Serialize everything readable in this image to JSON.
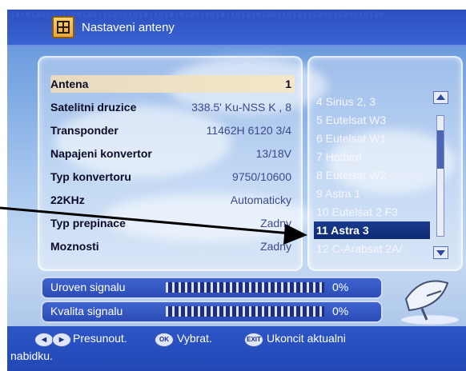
{
  "header": {
    "title": "Nastaveni anteny",
    "pattern": "1010100010110010011101010101101010100100101101010100110101110101101010100"
  },
  "settings": [
    {
      "label": "Antena",
      "value": "1",
      "selected": true
    },
    {
      "label": "Satelitni druzice",
      "value": "338.5' Ku-NSS K , 8"
    },
    {
      "label": "Transponder",
      "value": "11462H 6120 3/4"
    },
    {
      "label": "Napajeni konvertor",
      "value": "13/18V"
    },
    {
      "label": "Typ konvertoru",
      "value": "9750/10600"
    },
    {
      "label": "22KHz",
      "value": "Automaticky"
    },
    {
      "label": "Typ prepinace",
      "value": "Zadny"
    },
    {
      "label": "Moznosti",
      "value": "Zadny"
    }
  ],
  "satellites": [
    {
      "label": "4 Sirius 2, 3"
    },
    {
      "label": "5 Eutelsat W3"
    },
    {
      "label": "6 Eutelsat W1"
    },
    {
      "label": "7 Hotbird"
    },
    {
      "label": "8 Eutelsat W2"
    },
    {
      "label": "9 Astra 1"
    },
    {
      "label": "10 Eutelsat 2 F3"
    },
    {
      "label": "11 Astra 3",
      "selected": true
    },
    {
      "label": "12 C-Arabsat 2A/"
    }
  ],
  "signal": {
    "level": {
      "label": "Uroven signalu",
      "value": "0%",
      "fraction": 0
    },
    "quality": {
      "label": "Kvalita signalu",
      "value": "0%",
      "fraction": 0
    }
  },
  "footer": {
    "move_label": "Presunout.",
    "ok_key": "OK",
    "select_label": "Vybrat.",
    "exit_key": "EXIT",
    "exit_label": "Ukoncit aktualni",
    "exit_label_2": "nabidku."
  },
  "colors": {
    "highlight": "#f4e7c8",
    "selection": "#0e2b73",
    "title_bar": "#2b4fc0",
    "footer": "#2248b6"
  },
  "icons": [
    "antenna-menu-icon",
    "left-arrow-key-icon",
    "right-arrow-key-icon",
    "ok-key-icon",
    "exit-key-icon",
    "satellite-dish-icon",
    "scroll-up-icon",
    "scroll-down-icon"
  ]
}
